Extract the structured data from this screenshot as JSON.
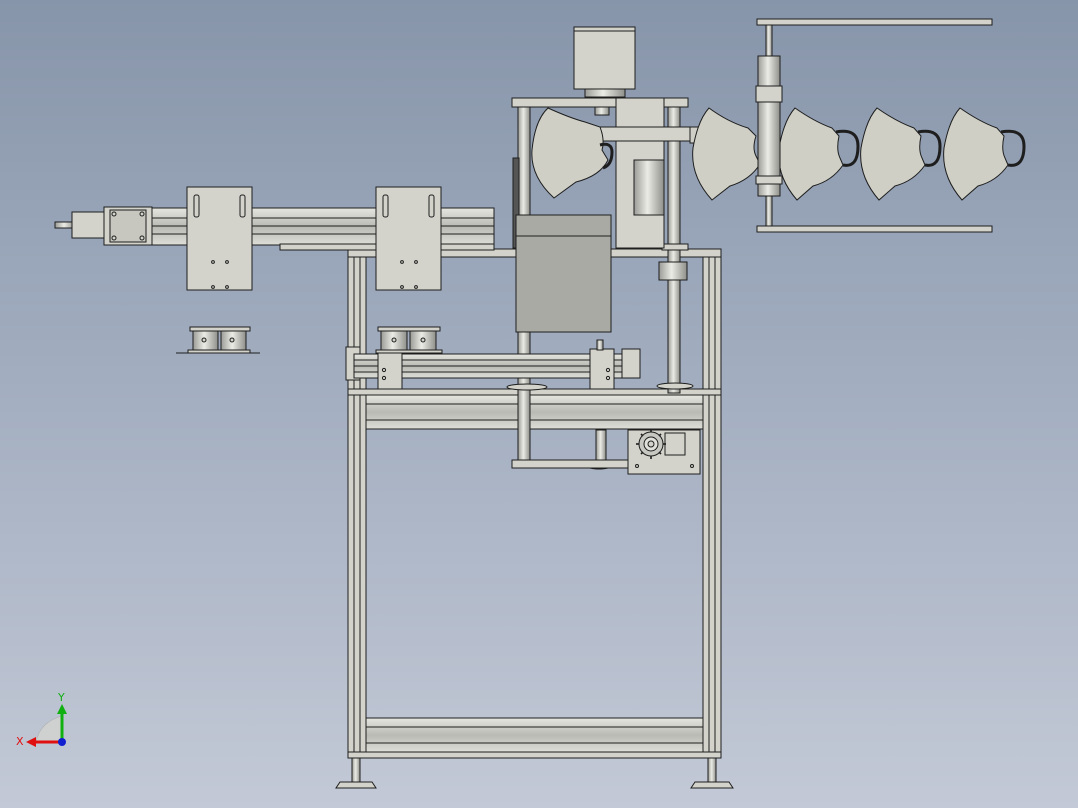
{
  "viewport": {
    "background_top": "#8795aa",
    "background_bottom": "#c3c9d6",
    "part_fill": "#d3d3cc",
    "part_stroke": "#1e1e1e",
    "dark_fill": "#a9aaa4"
  },
  "triad": {
    "x_label": "X",
    "y_label": "Y",
    "x_color": "#e01010",
    "y_color": "#10b010",
    "z_color": "#1020d0"
  }
}
